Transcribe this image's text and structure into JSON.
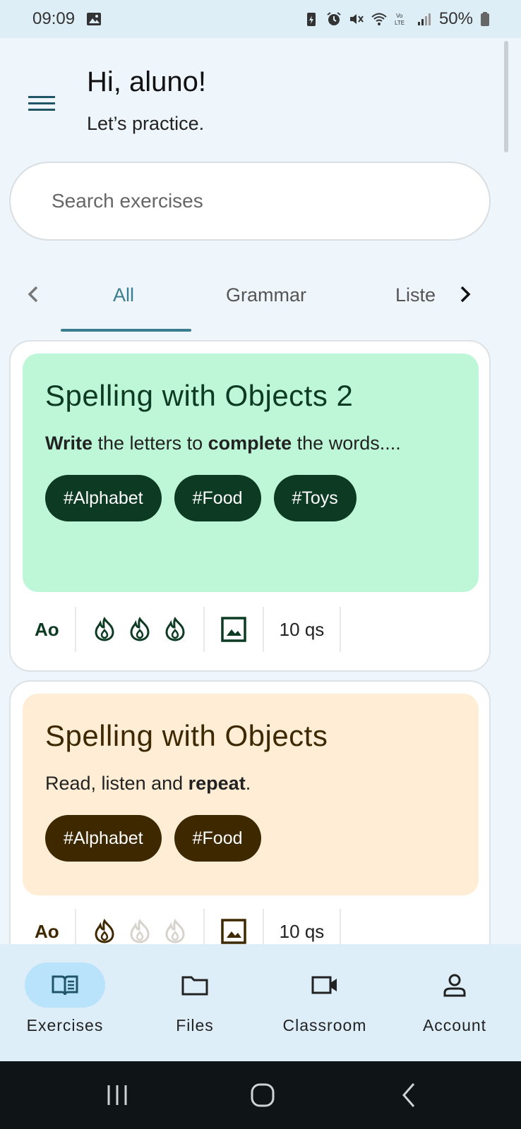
{
  "status_bar": {
    "time": "09:09",
    "battery": "50%"
  },
  "header": {
    "greeting": "Hi, aluno!",
    "subtitle": "Let’s practice."
  },
  "search": {
    "placeholder": "Search exercises"
  },
  "tabs": {
    "items": [
      {
        "label": "All",
        "active": true
      },
      {
        "label": "Grammar",
        "active": false
      },
      {
        "label": "Liste",
        "active": false
      }
    ]
  },
  "cards": [
    {
      "title": "Spelling with Objects 2",
      "desc_parts": [
        "Write",
        " the letters to ",
        "complete",
        " the words...."
      ],
      "tags": [
        "#Alphabet",
        "#Food",
        "#Toys"
      ],
      "level": "Ao",
      "difficulty": 3,
      "difficulty_max": 3,
      "questions": "10 qs",
      "bg": "#bdf7d8",
      "fg": "#0c3a22",
      "tag_bg": "#0c3a22"
    },
    {
      "title": "Spelling with Objects",
      "desc_parts": [
        "Read, listen and ",
        "repeat",
        "."
      ],
      "tags": [
        "#Alphabet",
        "#Food"
      ],
      "level": "Ao",
      "difficulty": 1,
      "difficulty_max": 3,
      "questions": "10 qs",
      "bg": "#ffeed5",
      "fg": "#3d2800",
      "tag_bg": "#3d2800"
    }
  ],
  "bottom_nav": {
    "items": [
      {
        "label": "Exercises",
        "icon": "book-icon",
        "active": true
      },
      {
        "label": "Files",
        "icon": "folder-icon",
        "active": false
      },
      {
        "label": "Classroom",
        "icon": "video-icon",
        "active": false
      },
      {
        "label": "Account",
        "icon": "person-icon",
        "active": false
      }
    ]
  },
  "colors": {
    "accent": "#3a7d8f",
    "card1_bg": "#bdf7d8",
    "card2_bg": "#ffeed5",
    "nav_active": "#b9e2fb"
  }
}
